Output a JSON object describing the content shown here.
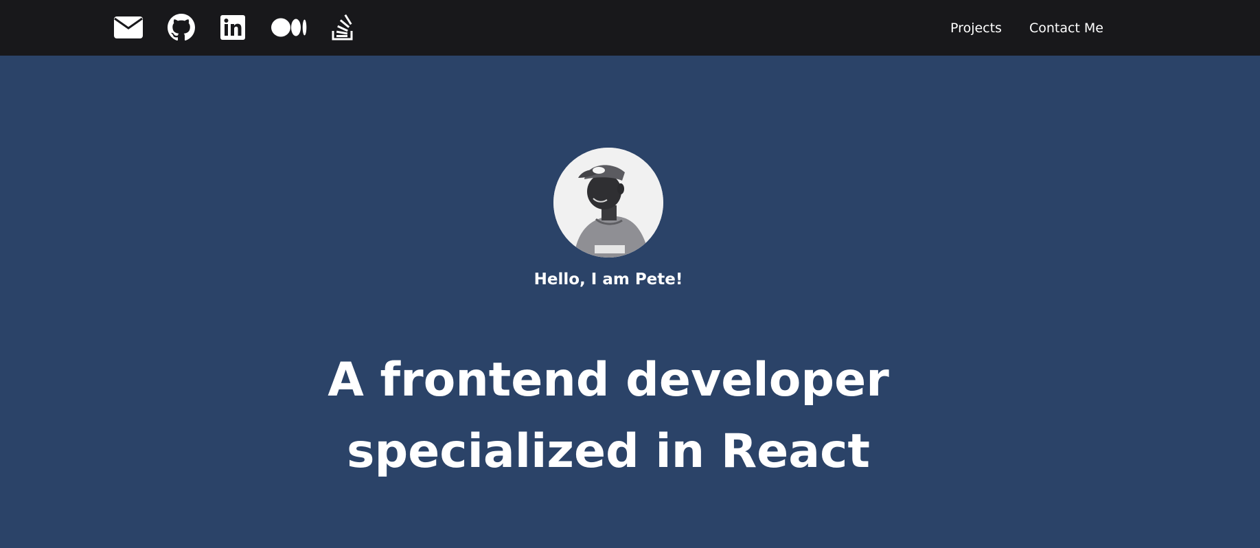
{
  "topbar": {
    "social_icons": [
      {
        "name": "envelope-icon",
        "label": "Email"
      },
      {
        "name": "github-icon",
        "label": "GitHub"
      },
      {
        "name": "linkedin-icon",
        "label": "LinkedIn"
      },
      {
        "name": "medium-icon",
        "label": "Medium"
      },
      {
        "name": "stackoverflow-icon",
        "label": "Stack Overflow"
      }
    ],
    "nav": {
      "projects": "Projects",
      "contact": "Contact Me"
    }
  },
  "hero": {
    "greeting": "Hello, I am Pete!",
    "headline_line1": "A frontend developer",
    "headline_line2": "specialized in React"
  },
  "colors": {
    "topbar_background": "#18181b",
    "hero_background": "#2b4368",
    "text": "#ffffff"
  }
}
